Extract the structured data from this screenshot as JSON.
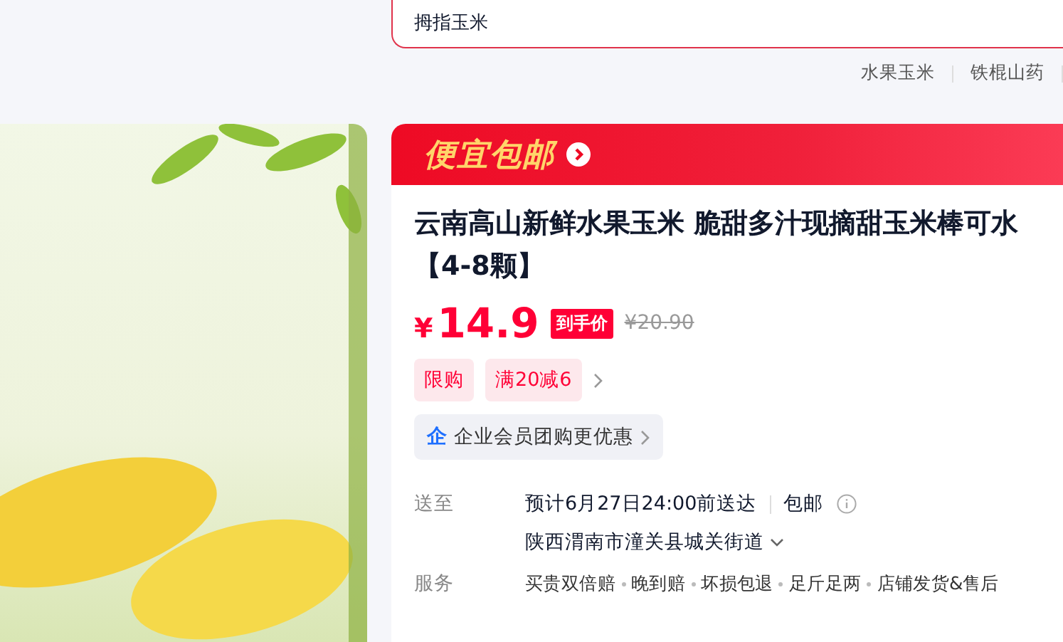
{
  "search": {
    "value": "拇指玉米"
  },
  "hot_searches": [
    "水果玉米",
    "铁棍山药"
  ],
  "promo_banner": {
    "label": "便宜包邮"
  },
  "product": {
    "title_lines": [
      "云南高山新鲜水果玉米 脆甜多汁现摘甜玉米棒可水",
      "【4-8颗】"
    ],
    "price": {
      "currency": "¥",
      "amount": "14.9",
      "tag": "到手价",
      "original": "¥20.90"
    },
    "promo_tags": [
      "限购",
      "满20减6"
    ],
    "enterprise": {
      "badge": "企",
      "label": "企业会员团购更优惠"
    },
    "delivery": {
      "label": "送至",
      "eta": "预计6月27日24:00前送达",
      "shipping": "包邮",
      "address": "陕西渭南市潼关县城关街道"
    },
    "services": {
      "label": "服务",
      "items": [
        "买贵双倍赔",
        "晚到赔",
        "坏损包退",
        "足斤足两",
        "店铺发货&售后"
      ]
    }
  }
}
